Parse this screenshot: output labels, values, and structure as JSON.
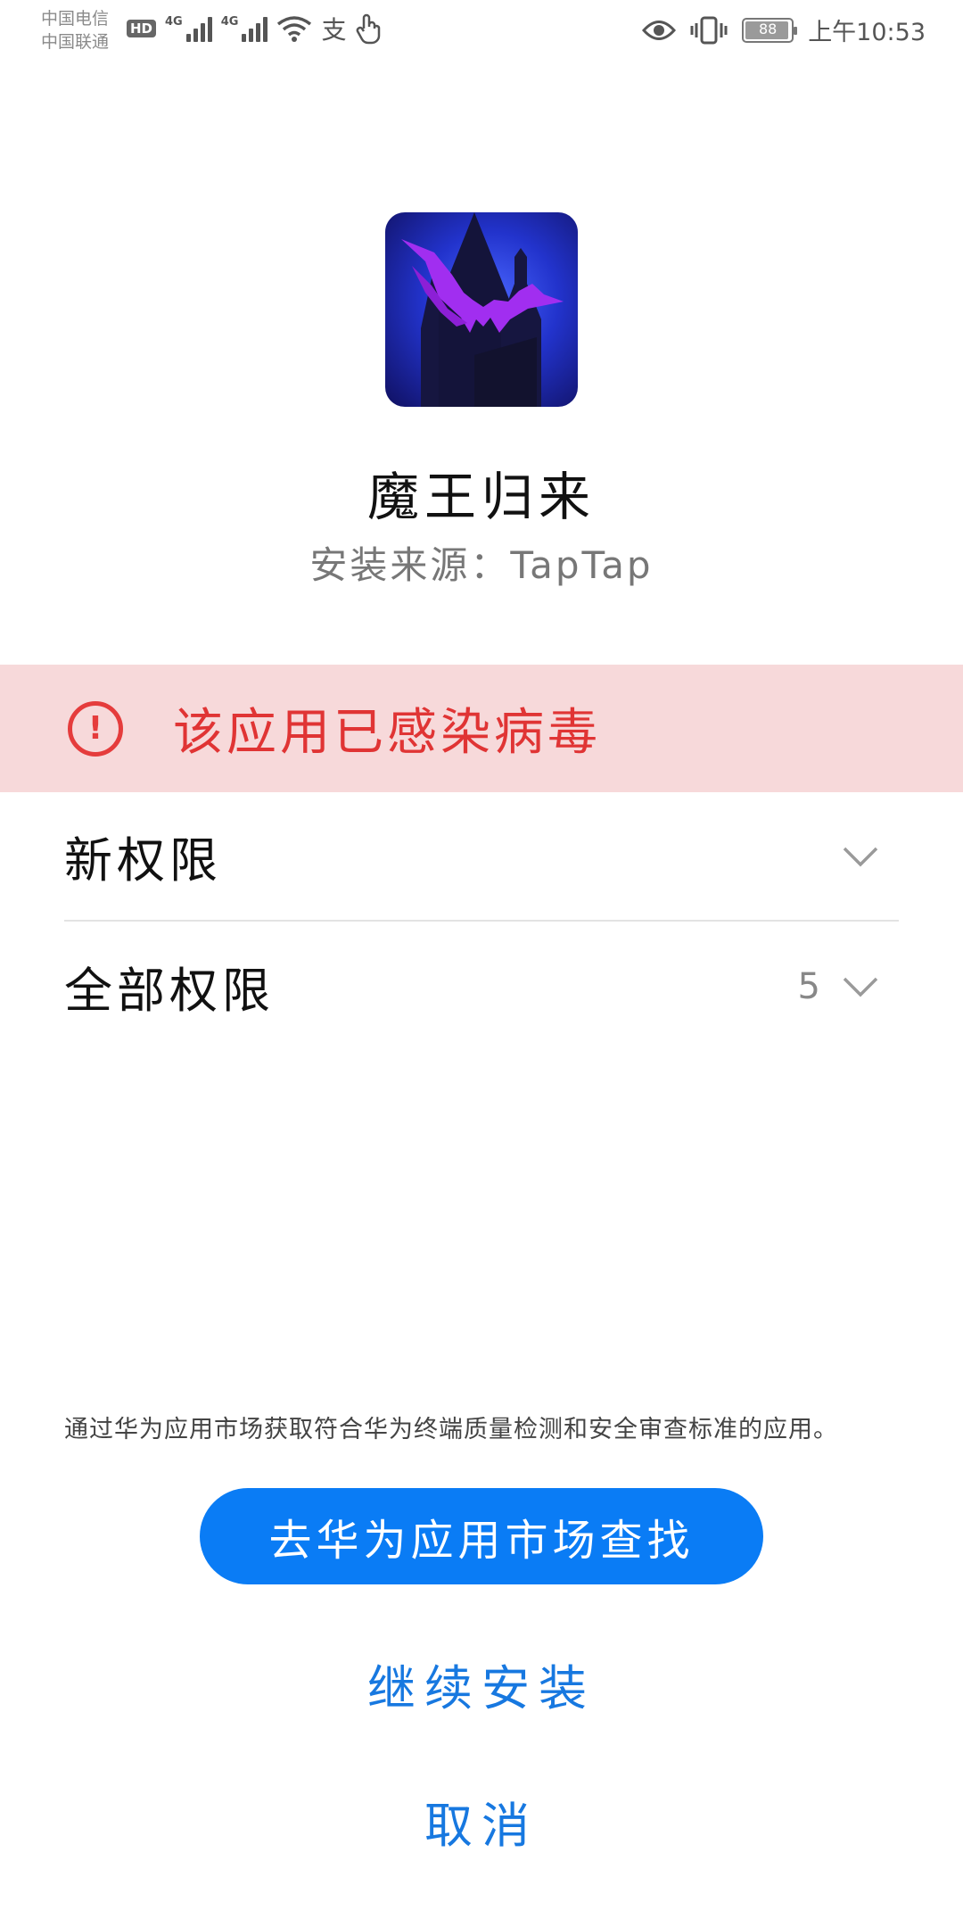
{
  "status_bar": {
    "carrier1": "中国电信",
    "carrier2": "中国联通",
    "hd_badge": "HD",
    "network1": "4G",
    "network2": "4G",
    "battery": "88",
    "time": "上午10:53",
    "icons": [
      "hd-icon",
      "signal-icon",
      "signal-icon",
      "wifi-icon",
      "alipay-icon",
      "touch-icon",
      "eye-icon",
      "vibrate-icon",
      "battery-icon"
    ]
  },
  "app": {
    "name": "魔王归来",
    "source": "安装来源：TapTap",
    "icon": "castle-bat-app-icon"
  },
  "warning": {
    "text": "该应用已感染病毒",
    "color": "#e03434",
    "icon": "exclamation-circle-icon"
  },
  "permissions": {
    "new_label": "新权限",
    "all_label": "全部权限",
    "all_count": "5"
  },
  "footer": {
    "notice": "通过华为应用市场获取符合华为终端质量检测和安全审查标准的应用。",
    "primary_button": "去华为应用市场查找",
    "continue_button": "继续安装",
    "cancel_button": "取消"
  },
  "colors": {
    "primary": "#0a7cf5",
    "warning_bg": "#f7d9da",
    "link": "#1778e0"
  }
}
